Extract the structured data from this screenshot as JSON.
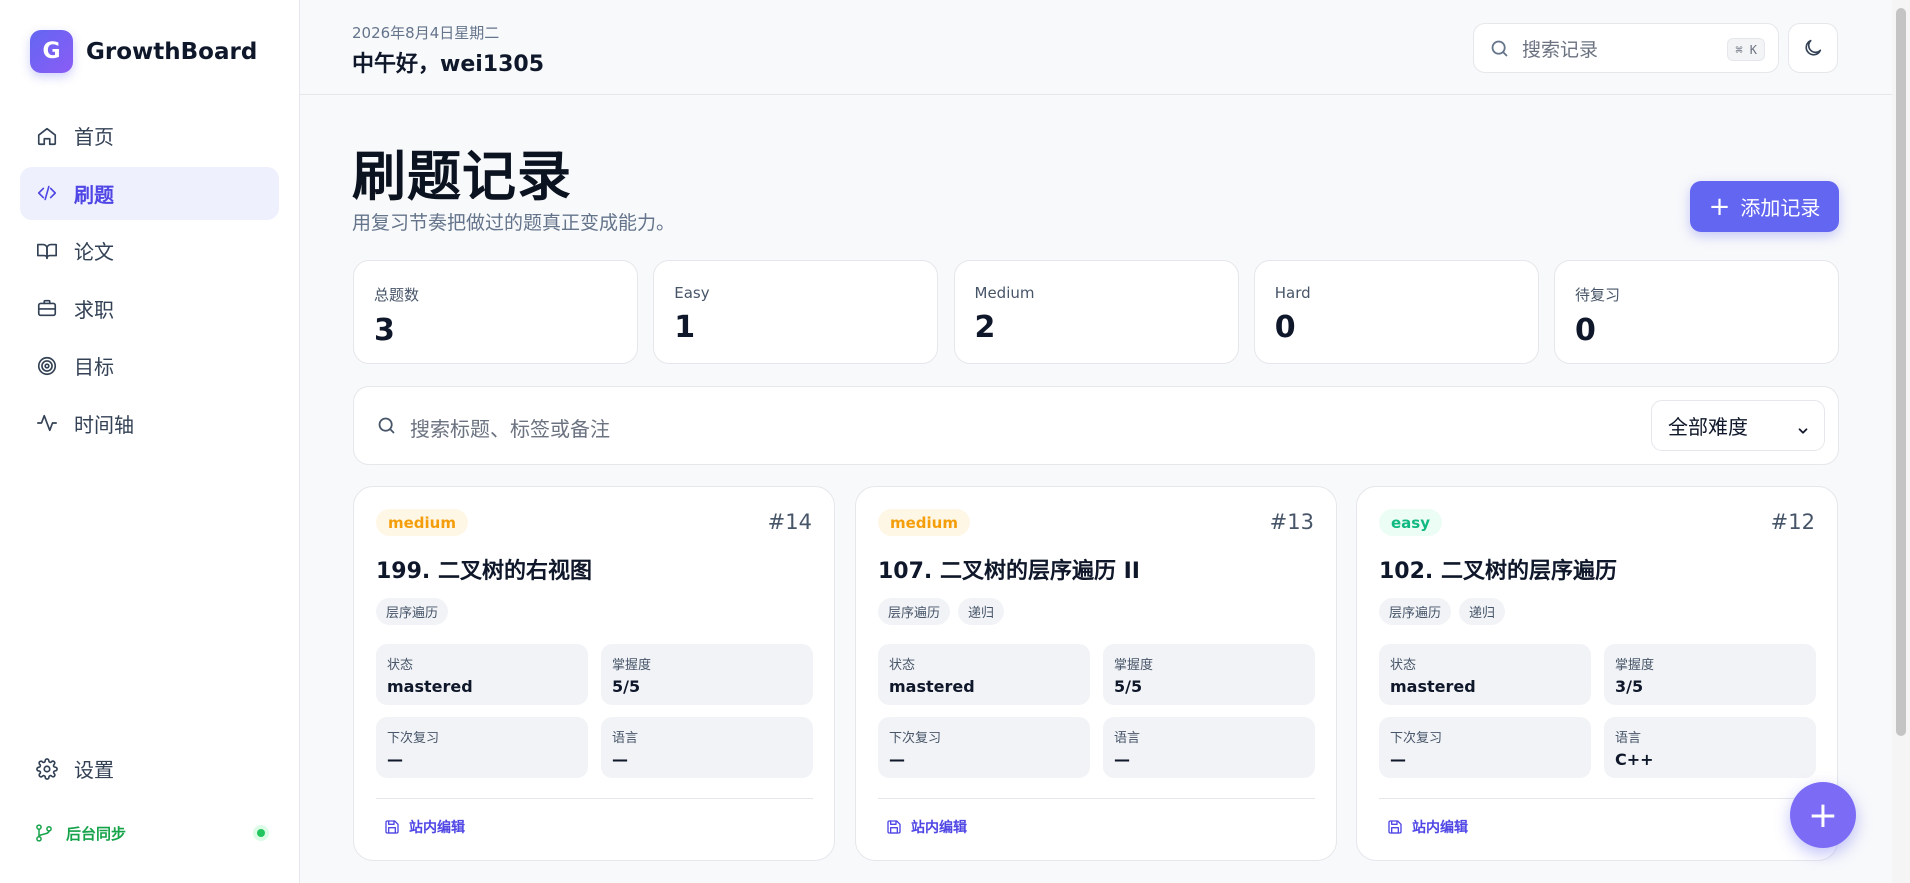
{
  "brand": {
    "logo_letter": "G",
    "name": "GrowthBoard"
  },
  "nav": [
    {
      "label": "首页",
      "icon": "home-icon",
      "active": false
    },
    {
      "label": "刷题",
      "icon": "code-icon",
      "active": true
    },
    {
      "label": "论文",
      "icon": "book-icon",
      "active": false
    },
    {
      "label": "求职",
      "icon": "briefcase-icon",
      "active": false
    },
    {
      "label": "目标",
      "icon": "target-icon",
      "active": false
    },
    {
      "label": "时间轴",
      "icon": "activity-icon",
      "active": false
    }
  ],
  "settings": {
    "label": "设置",
    "icon": "gear-icon"
  },
  "sync": {
    "label": "后台同步",
    "icon": "git-branch-icon",
    "status_color": "#22c55e"
  },
  "header": {
    "date": "2026年8月4日星期二",
    "greeting": "中午好，wei1305"
  },
  "search": {
    "placeholder": "搜索记录",
    "shortcut": "⌘ K"
  },
  "page": {
    "title": "刷题记录",
    "subtitle": "用复习节奏把做过的题真正变成能力。",
    "add_label": "添加记录"
  },
  "stats": [
    {
      "label": "总题数",
      "value": "3"
    },
    {
      "label": "Easy",
      "value": "1"
    },
    {
      "label": "Medium",
      "value": "2"
    },
    {
      "label": "Hard",
      "value": "0"
    },
    {
      "label": "待复习",
      "value": "0"
    }
  ],
  "filter": {
    "placeholder": "搜索标题、标签或备注",
    "difficulty_selected": "全部难度"
  },
  "cards": [
    {
      "difficulty": "medium",
      "number": "#14",
      "title": "199. 二叉树的右视图",
      "tags": [
        "层序遍历"
      ],
      "fields": [
        {
          "label": "状态",
          "value": "mastered"
        },
        {
          "label": "掌握度",
          "value": "5/5"
        },
        {
          "label": "下次复习",
          "value": "—"
        },
        {
          "label": "语言",
          "value": "—"
        }
      ],
      "edit_label": "站内编辑"
    },
    {
      "difficulty": "medium",
      "number": "#13",
      "title": "107. 二叉树的层序遍历 II",
      "tags": [
        "层序遍历",
        "递归"
      ],
      "fields": [
        {
          "label": "状态",
          "value": "mastered"
        },
        {
          "label": "掌握度",
          "value": "5/5"
        },
        {
          "label": "下次复习",
          "value": "—"
        },
        {
          "label": "语言",
          "value": "—"
        }
      ],
      "edit_label": "站内编辑"
    },
    {
      "difficulty": "easy",
      "number": "#12",
      "title": "102. 二叉树的层序遍历",
      "tags": [
        "层序遍历",
        "递归"
      ],
      "fields": [
        {
          "label": "状态",
          "value": "mastered"
        },
        {
          "label": "掌握度",
          "value": "3/5"
        },
        {
          "label": "下次复习",
          "value": "—"
        },
        {
          "label": "语言",
          "value": "C++"
        }
      ],
      "edit_label": "站内编辑"
    }
  ],
  "fab": {
    "label": "+"
  },
  "colors": {
    "accent": "#6366f1",
    "medium": "#f59e0b",
    "easy": "#10b981"
  }
}
